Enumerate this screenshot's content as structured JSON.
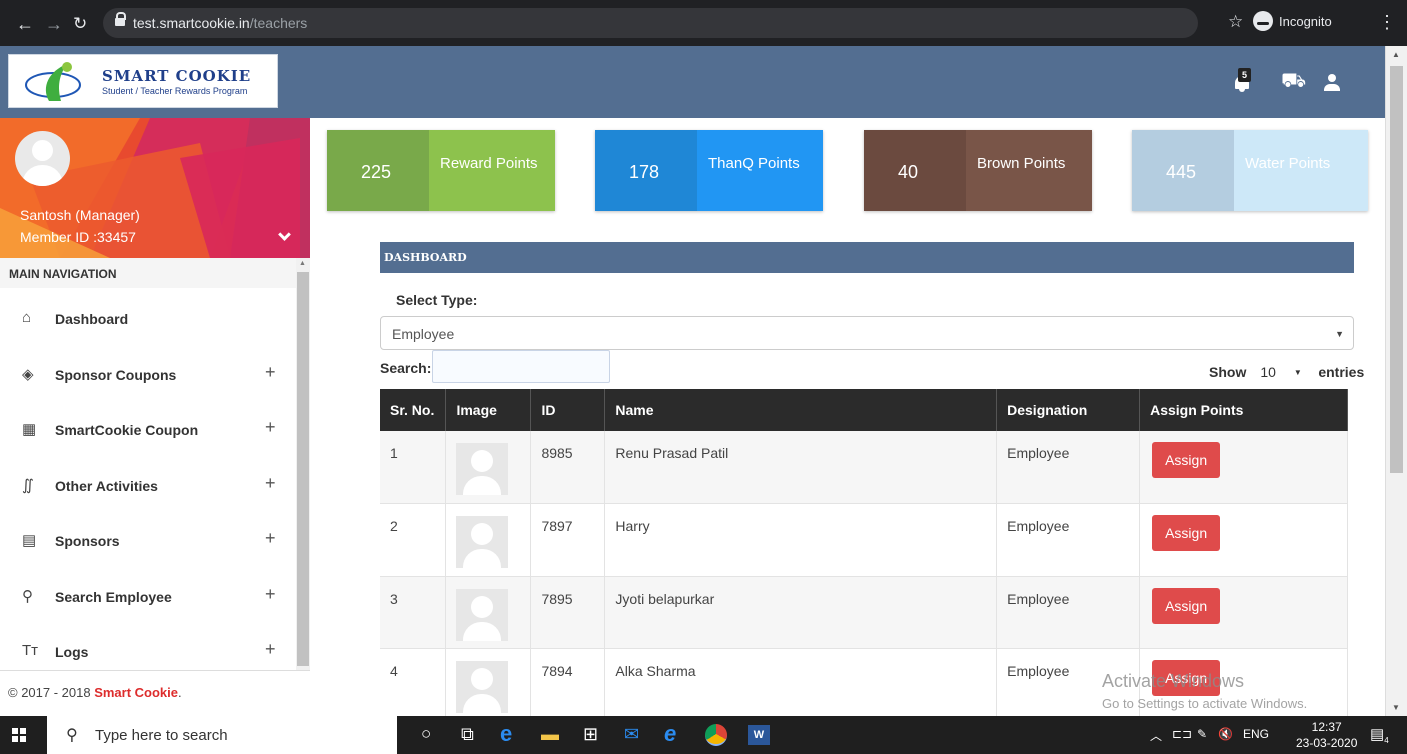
{
  "browser": {
    "url_host": "test.smartcookie.in",
    "url_path": "/teachers",
    "incognito_label": "Incognito",
    "icons": [
      "back-arrow-icon",
      "forward-arrow-icon",
      "reload-icon",
      "lock-icon",
      "star-icon",
      "incognito-icon",
      "kebab-menu-icon"
    ]
  },
  "header": {
    "logo_title": "SMART COOKIE",
    "logo_subtitle": "Student / Teacher Rewards Program",
    "notification_count": "5",
    "colors": {
      "bar": "#536e91"
    }
  },
  "profile": {
    "name": "Santosh (Manager)",
    "member_id": "Member ID :33457"
  },
  "sidebar": {
    "heading": "MAIN NAVIGATION",
    "items": [
      {
        "label": "Dashboard",
        "icon": "home-icon",
        "glyph": "⌂",
        "expandable": false
      },
      {
        "label": "Sponsor Coupons",
        "icon": "layers-icon",
        "glyph": "◈",
        "expandable": true
      },
      {
        "label": "SmartCookie Coupon",
        "icon": "grid-icon",
        "glyph": "▦",
        "expandable": true
      },
      {
        "label": "Other Activities",
        "icon": "activity-icon",
        "glyph": "∬",
        "expandable": true
      },
      {
        "label": "Sponsors",
        "icon": "clipboard-icon",
        "glyph": "▤",
        "expandable": true
      },
      {
        "label": "Search Employee",
        "icon": "search-icon",
        "glyph": "⚲",
        "expandable": true
      },
      {
        "label": "Logs",
        "icon": "text-size-icon",
        "glyph": "Tт",
        "expandable": true
      }
    ],
    "plus": "+",
    "footer_text": "© 2017 - 2018 ",
    "footer_brand": "Smart Cookie",
    "footer_end": "."
  },
  "points": [
    {
      "value": "225",
      "label": "Reward Points",
      "dark": "#79a94a",
      "light": "#8dc24d"
    },
    {
      "value": "178",
      "label": "ThanQ Points",
      "dark": "#1f87d6",
      "light": "#2196f3"
    },
    {
      "value": "40",
      "label": "Brown Points",
      "dark": "#6b4a3f",
      "light": "#795548"
    },
    {
      "value": "445",
      "label": "Water Points",
      "dark": "#b4cde0",
      "light": "#cde8f8"
    }
  ],
  "dashboard": {
    "title": "DASHBOARD",
    "select_label": "Select Type:",
    "select_value": "Employee",
    "search_label": "Search:",
    "show_label": "Show",
    "show_value": "10",
    "entries_label": "entries"
  },
  "table": {
    "headers": [
      "Sr. No.",
      "Image",
      "ID",
      "Name",
      "Designation",
      "Assign Points"
    ],
    "rows": [
      {
        "sr": "1",
        "id": "8985",
        "name": "Renu Prasad Patil",
        "designation": "Employee",
        "action": "Assign"
      },
      {
        "sr": "2",
        "id": "7897",
        "name": "Harry",
        "designation": "Employee",
        "action": "Assign"
      },
      {
        "sr": "3",
        "id": "7895",
        "name": "Jyoti belapurkar",
        "designation": "Employee",
        "action": "Assign"
      },
      {
        "sr": "4",
        "id": "7894",
        "name": "Alka Sharma",
        "designation": "Employee",
        "action": "Assign"
      }
    ]
  },
  "watermark": {
    "line1": "Activate Windows",
    "line2": "Go to Settings to activate Windows."
  },
  "taskbar": {
    "search_placeholder": "Type here to search",
    "lang": "ENG",
    "time": "12:37",
    "date": "23-03-2020",
    "notification_count": "4"
  }
}
